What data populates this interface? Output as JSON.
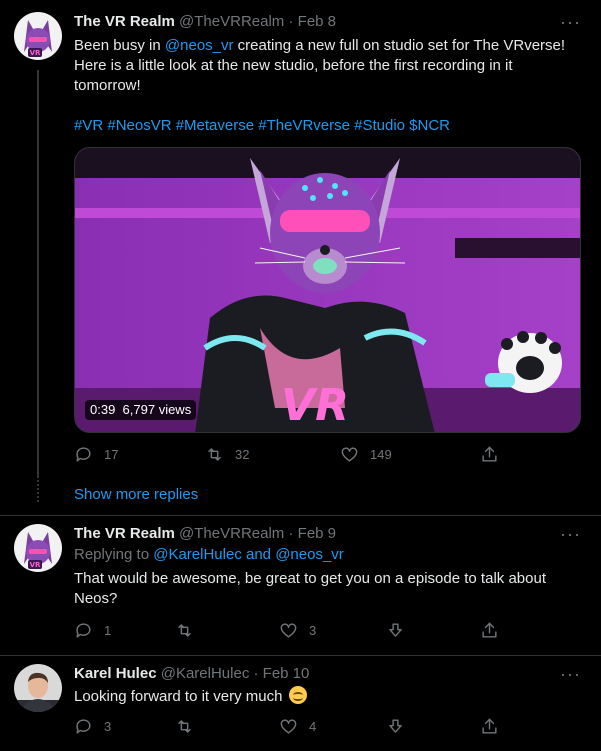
{
  "tweets": [
    {
      "name": "The VR Realm",
      "handle": "@TheVRRealm",
      "sep": "·",
      "date": "Feb 8",
      "text_pre": "Been busy in ",
      "mention": "@neos_vr",
      "text_post": " creating a new full on studio set for The VRverse! Here is a little look at the new studio, before the first recording in it tomorrow!",
      "hashtags": "#VR #NeosVR #Metaverse #TheVRverse #Studio $NCR",
      "video_duration": "0:39",
      "video_views": "6,797 views",
      "replies": "17",
      "retweets": "32",
      "likes": "149"
    },
    {
      "name": "The VR Realm",
      "handle": "@TheVRRealm",
      "sep": "·",
      "date": "Feb 9",
      "replying_prefix": "Replying to ",
      "replying_user1": "@KarelHulec",
      "replying_and": " and ",
      "replying_user2": "@neos_vr",
      "text": "That would be awesome, be great to get you on a episode to talk about Neos?",
      "replies": "1",
      "retweets": "",
      "likes": "3"
    },
    {
      "name": "Karel Hulec",
      "handle": "@KarelHulec",
      "sep": "·",
      "date": "Feb 10",
      "text": "Looking forward to it very much",
      "replies": "3",
      "retweets": "",
      "likes": "4"
    }
  ],
  "show_more": "Show more replies",
  "more_glyph": "···",
  "avatar_badge": "VR",
  "video_text": "VR",
  "colors": {
    "accent": "#1d9bf0",
    "muted": "#71767b",
    "text": "#e7e9ea",
    "background": "#000000"
  },
  "icons": [
    "more-icon",
    "reply-icon",
    "retweet-icon",
    "like-icon",
    "share-icon",
    "downvote-icon"
  ]
}
